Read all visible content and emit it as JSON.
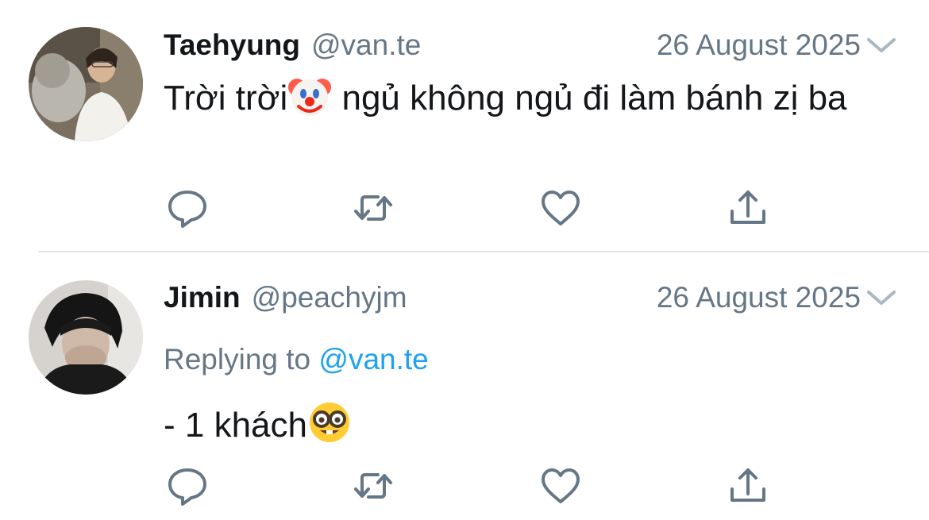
{
  "colors": {
    "name": "#14171a",
    "muted": "#657786",
    "link": "#1da1f2",
    "icon": "#657786",
    "divider": "#e1e8ed"
  },
  "tweets": [
    {
      "name": "Taehyung",
      "handle": "@van.te",
      "date": "26 August 2025",
      "text_before_emoji": "Trời trời",
      "emoji": "clown-face-emoji",
      "text_after_emoji": " ngủ không ngủ đi làm bánh zị ba",
      "actions": [
        "reply-icon",
        "retweet-icon",
        "like-icon",
        "share-icon"
      ]
    },
    {
      "name": "Jimin",
      "handle": "@peachyjm",
      "date": "26 August 2025",
      "replying_label": "Replying to",
      "replying_to": "@van.te",
      "text_before_emoji": "- 1 khách",
      "emoji": "nerd-face-emoji",
      "actions": [
        "reply-icon",
        "retweet-icon",
        "like-icon",
        "share-icon"
      ]
    }
  ]
}
